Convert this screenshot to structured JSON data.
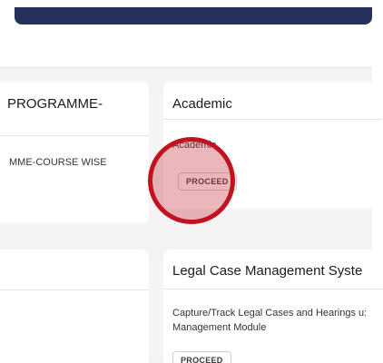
{
  "cards": [
    {
      "title": "PROGRAMME-",
      "description": "MME-COURSE WISE"
    },
    {
      "title": "Academic",
      "description": "Academic",
      "button": "PROCEED"
    },
    {
      "title": ""
    },
    {
      "title": "Legal Case Management Syste",
      "description": "Capture/Track Legal Cases and Hearings u: Management Module",
      "button": "PROCEED"
    }
  ],
  "colors": {
    "header": "#27305a",
    "highlight": "#c1121f"
  }
}
